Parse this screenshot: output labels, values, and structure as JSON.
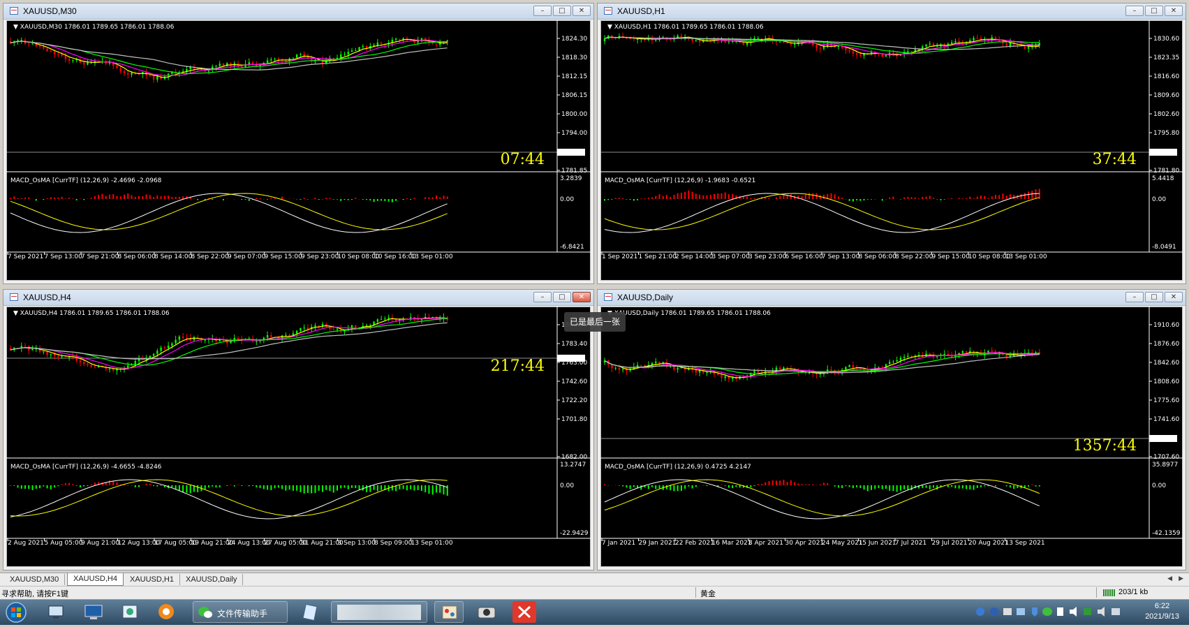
{
  "windows": [
    {
      "title": "XAUUSD,M30",
      "info": "XAUUSD,M30  1786.01 1789.65 1786.01 1788.06",
      "macd_info": "MACD_OsMA [CurrTF] (12,26,9) -2.4696 -2.0968",
      "time_label": "07:44",
      "price_ticks": [
        "1824.30",
        "1818.30",
        "1812.15",
        "1806.15",
        "1800.00",
        "1794.00",
        "1781.85"
      ],
      "current_price": "1788.06",
      "macd_ticks": [
        "3.2839",
        "0.00",
        "-6.8421"
      ],
      "dates": [
        "7 Sep 2021",
        "7 Sep 13:00",
        "7 Sep 21:00",
        "8 Sep 06:00",
        "8 Sep 14:00",
        "8 Sep 22:00",
        "9 Sep 07:00",
        "9 Sep 15:00",
        "9 Sep 23:00",
        "10 Sep 08:00",
        "10 Sep 16:00",
        "13 Sep 01:00"
      ]
    },
    {
      "title": "XAUUSD,H1",
      "info": "XAUUSD,H1  1786.01 1789.65 1786.01 1788.06",
      "macd_info": "MACD_OsMA [CurrTF] (12,26,9) -1.9683 -0.6521",
      "time_label": "37:44",
      "price_ticks": [
        "1830.60",
        "1823.35",
        "1816.60",
        "1809.60",
        "1802.60",
        "1795.80",
        "1781.80"
      ],
      "current_price": "1788.06",
      "macd_ticks": [
        "5.4418",
        "0.00",
        "-8.0491"
      ],
      "dates": [
        "1 Sep 2021",
        "1 Sep 21:00",
        "2 Sep 14:00",
        "3 Sep 07:00",
        "3 Sep 23:00",
        "6 Sep 16:00",
        "7 Sep 13:00",
        "8 Sep 06:00",
        "8 Sep 22:00",
        "9 Sep 15:00",
        "10 Sep 08:00",
        "13 Sep 01:00"
      ]
    },
    {
      "title": "XAUUSD,H4",
      "info": "XAUUSD,H4  1786.01 1789.65 1786.01 1788.06",
      "macd_info": "MACD_OsMA [CurrTF] (12,26,9) -4.6655 -4.8246",
      "time_label": "217:44",
      "price_ticks": [
        "1803.88",
        "1783.40",
        "1763.00",
        "1742.60",
        "1722.20",
        "1701.80",
        "1682.00"
      ],
      "current_price": "1788.06",
      "macd_ticks": [
        "13.2747",
        "0.00",
        "-22.9429"
      ],
      "dates": [
        "2 Aug 2021",
        "5 Aug 05:00",
        "9 Aug 21:00",
        "12 Aug 13:00",
        "17 Aug 05:00",
        "19 Aug 21:00",
        "24 Aug 13:00",
        "27 Aug 05:00",
        "31 Aug 21:00",
        "3 Sep 13:00",
        "8 Sep 09:00",
        "13 Sep 01:00"
      ]
    },
    {
      "title": "XAUUSD,Daily",
      "info": "XAUUSD,Daily  1786.01 1789.65 1786.01 1788.06",
      "macd_info": "MACD_OsMA [CurrTF] (12,26,9) 0.4725 4.2147",
      "time_label": "1357:44",
      "price_ticks": [
        "1910.60",
        "1876.60",
        "1842.60",
        "1808.60",
        "1775.60",
        "1741.60",
        "1707.60"
      ],
      "current_price": "1788.06",
      "macd_ticks": [
        "35.8977",
        "0.00",
        "-42.1359"
      ],
      "dates": [
        "7 Jan 2021",
        "29 Jan 2021",
        "22 Feb 2021",
        "16 Mar 2021",
        "8 Apr 2021",
        "30 Apr 2021",
        "24 May 2021",
        "15 Jun 2021",
        "7 Jul 2021",
        "29 Jul 2021",
        "20 Aug 2021",
        "13 Sep 2021"
      ]
    }
  ],
  "tooltip": "已是最后一张",
  "tabs": [
    "XAUUSD,M30",
    "XAUUSD,H4",
    "XAUUSD,H1",
    "XAUUSD,Daily"
  ],
  "active_tab": "XAUUSD,H4",
  "status": {
    "help": "寻求帮助, 请按F1键",
    "symbol_name": "黄金",
    "traffic": "203/1 kb"
  },
  "taskbar": {
    "wechat_label": "文件传输助手",
    "time": "6:22",
    "date": "2021/9/13"
  },
  "colors": {
    "background": "#000000",
    "bull": "#00ff00",
    "bear": "#ff0000",
    "ma_fast": "#ffff00",
    "ma_mid": "#ff00ff",
    "ma_slow": "#00ff00",
    "ma_long": "#c0c0c0",
    "time_label": "#ffff00"
  }
}
